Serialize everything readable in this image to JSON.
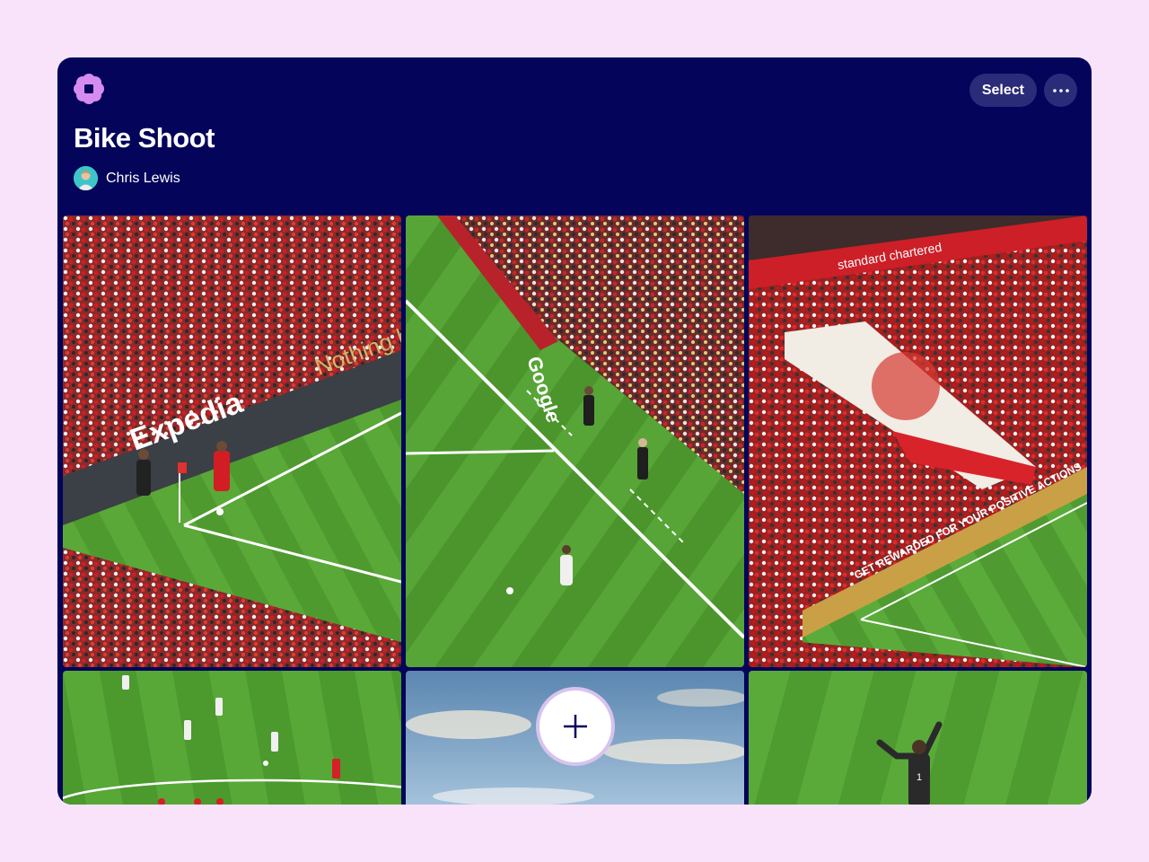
{
  "header": {
    "logo_icon": "flower-icon",
    "select_label": "Select",
    "more_icon": "ellipsis-icon"
  },
  "album": {
    "title": "Bike Shoot",
    "author": "Chris Lewis"
  },
  "colors": {
    "page_background": "#f9e3fb",
    "window_background": "#03045a",
    "button_background": "#2a2c7a",
    "logo": "#d58cf0",
    "add_ring": "#d7c3ee"
  },
  "photos": [
    {
      "id": "corner-kick",
      "ad_board": "Expedia",
      "banner": "Nothing b"
    },
    {
      "id": "sideline-throw",
      "ad_board": "Google"
    },
    {
      "id": "stand-banner",
      "ad_board": "standard chartered",
      "banner": "GET REWARDED FOR YOUR POSITIVE ACTIONS"
    },
    {
      "id": "players-midfield"
    },
    {
      "id": "sky"
    },
    {
      "id": "goalkeeper"
    }
  ],
  "add_photo_icon": "plus-icon"
}
